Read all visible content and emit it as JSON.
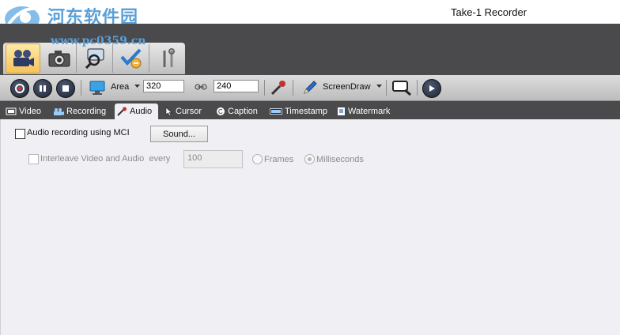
{
  "window": {
    "title": "Take-1 Recorder"
  },
  "watermark": {
    "site_name": "河东软件园",
    "url": "www.pc0359.cn"
  },
  "toolbar": {
    "area_label": "Area",
    "width_value": "320",
    "height_value": "240",
    "screendraw_label": "ScreenDraw"
  },
  "tabs": [
    {
      "label": "Video",
      "icon": "film-icon"
    },
    {
      "label": "Recording",
      "icon": "camera-icon"
    },
    {
      "label": "Audio",
      "icon": "microphone-icon",
      "active": true
    },
    {
      "label": "Cursor",
      "icon": "cursor-icon"
    },
    {
      "label": "Caption",
      "icon": "caption-icon"
    },
    {
      "label": "Timestamp",
      "icon": "timestamp-icon"
    },
    {
      "label": "Watermark",
      "icon": "watermark-icon"
    }
  ],
  "audio": {
    "mci_label": "Audio recording using MCI",
    "mci_checked": false,
    "sound_button": "Sound...",
    "interleave_label": "Interleave Video and Audio  every",
    "interleave_value": "100",
    "frames_label": "Frames",
    "ms_label": "Milliseconds",
    "unit_selected": "Milliseconds"
  },
  "colors": {
    "dark_band": "#4a4a4c",
    "panel": "#f0eff3",
    "active_mode": "#f5c35a"
  }
}
